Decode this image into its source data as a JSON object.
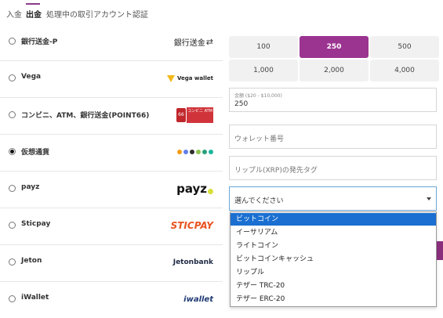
{
  "tabs": [
    "入金",
    "出金",
    "処理中の取引",
    "アカウント認証"
  ],
  "methods": [
    {
      "label": "銀行送金-P",
      "logo": "銀行送金",
      "checked": false
    },
    {
      "label": "Vega",
      "logo": "Vega wallet",
      "checked": false
    },
    {
      "label": "コンビニ、ATM、銀行送金(POINT66)",
      "logo": "コンビニ ATM",
      "checked": false
    },
    {
      "label": "仮想通貨",
      "logo": "crypto-icons",
      "checked": true
    },
    {
      "label": "payz",
      "logo": "payz",
      "checked": false
    },
    {
      "label": "Sticpay",
      "logo": "STICPAY",
      "checked": false
    },
    {
      "label": "Jeton",
      "logo": "Jetonbank",
      "checked": false
    },
    {
      "label": "iWallet",
      "logo": "iwallet",
      "checked": false
    }
  ],
  "amounts": [
    "100",
    "250",
    "500",
    "1,000",
    "2,000",
    "4,000"
  ],
  "selected_amount_index": 1,
  "amount_field": {
    "label": "金額 ($20 - $10,000)",
    "value": "250"
  },
  "wallet_field": {
    "placeholder": "ウォレット番号"
  },
  "tag_field": {
    "placeholder": "リップル(XRP)の発先タグ"
  },
  "currency_select": {
    "value": "選んでください"
  },
  "dropdown_options": [
    "ビットコイン",
    "イーサリアム",
    "ライトコイン",
    "ビットコインキャッシュ",
    "リップル",
    "テザー TRC-20",
    "テザー ERC-20"
  ],
  "highlighted_option_index": 0,
  "colors": {
    "accent": "#9b3490",
    "highlight": "#1a6fd1",
    "sticpay": "#e8531f",
    "payz_dot": "#d7e03a"
  }
}
